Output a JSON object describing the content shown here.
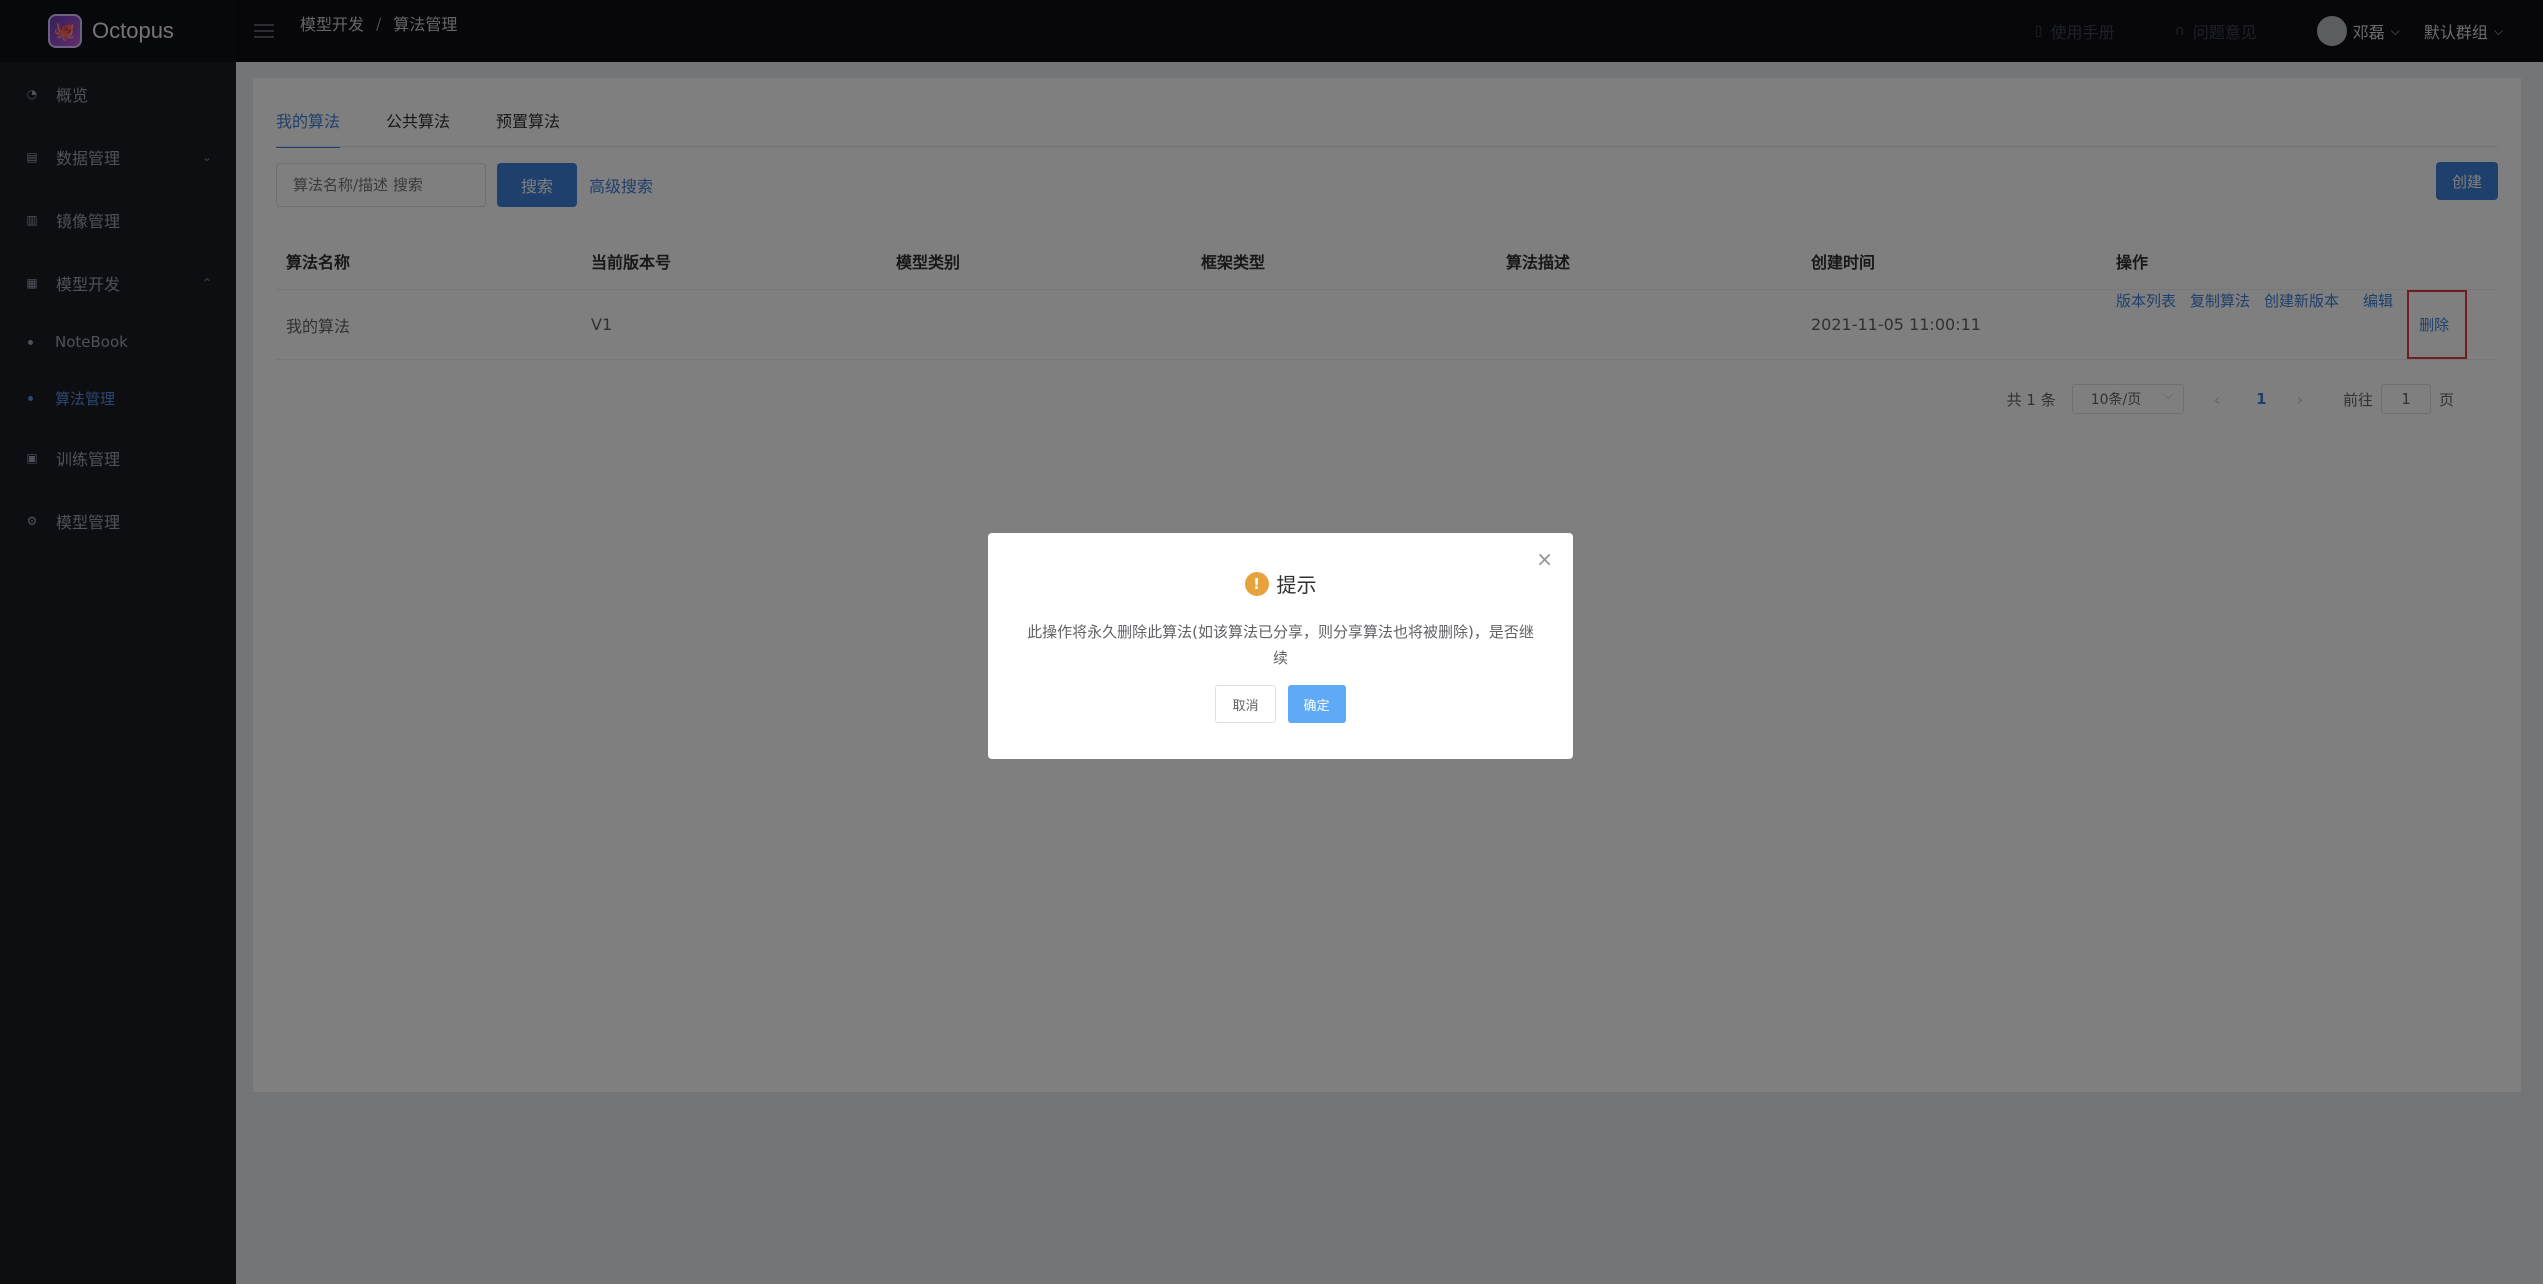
{
  "app": {
    "name": "Octopus"
  },
  "sidebar": {
    "items": [
      {
        "label": "概览",
        "icon": "dashboard-icon"
      },
      {
        "label": "数据管理",
        "icon": "database-icon",
        "expandable": true
      },
      {
        "label": "镜像管理",
        "icon": "image-icon"
      },
      {
        "label": "模型开发",
        "icon": "model-dev-icon",
        "expandable": true,
        "expanded": true
      },
      {
        "label": "训练管理",
        "icon": "training-icon"
      },
      {
        "label": "模型管理",
        "icon": "model-icon"
      }
    ],
    "subitems": [
      {
        "label": "NoteBook",
        "active": false
      },
      {
        "label": "算法管理",
        "active": true
      }
    ]
  },
  "header": {
    "breadcrumb": [
      "模型开发",
      "算法管理"
    ],
    "manual": "使用手册",
    "feedback": "问题意见",
    "user": "邓磊",
    "group": "默认群组"
  },
  "tabs": [
    "我的算法",
    "公共算法",
    "预置算法"
  ],
  "active_tab": 0,
  "search": {
    "placeholder": "算法名称/描述 搜索",
    "button": "搜索",
    "advanced": "高级搜索",
    "create": "创建"
  },
  "table": {
    "columns": [
      "算法名称",
      "当前版本号",
      "模型类别",
      "框架类型",
      "算法描述",
      "创建时间",
      "操作"
    ],
    "rows": [
      {
        "name": "我的算法",
        "version": "V1",
        "model_type": "",
        "framework": "",
        "description": "",
        "created": "2021-11-05 11:00:11",
        "actions": [
          "版本列表",
          "复制算法",
          "创建新版本",
          "编辑",
          "删除"
        ]
      }
    ]
  },
  "pagination": {
    "total": "共 1 条",
    "page_size": "10条/页",
    "current": "1",
    "goto_label": "前往",
    "goto_value": "1",
    "page_unit": "页"
  },
  "dialog": {
    "title": "提示",
    "message": "此操作将永久删除此算法(如该算法已分享，则分享算法也将被删除)，是否继续",
    "cancel": "取消",
    "confirm": "确定"
  },
  "colors": {
    "primary": "#3f7fd8",
    "warning": "#e6a23c",
    "highlight": "#e03b3b"
  }
}
